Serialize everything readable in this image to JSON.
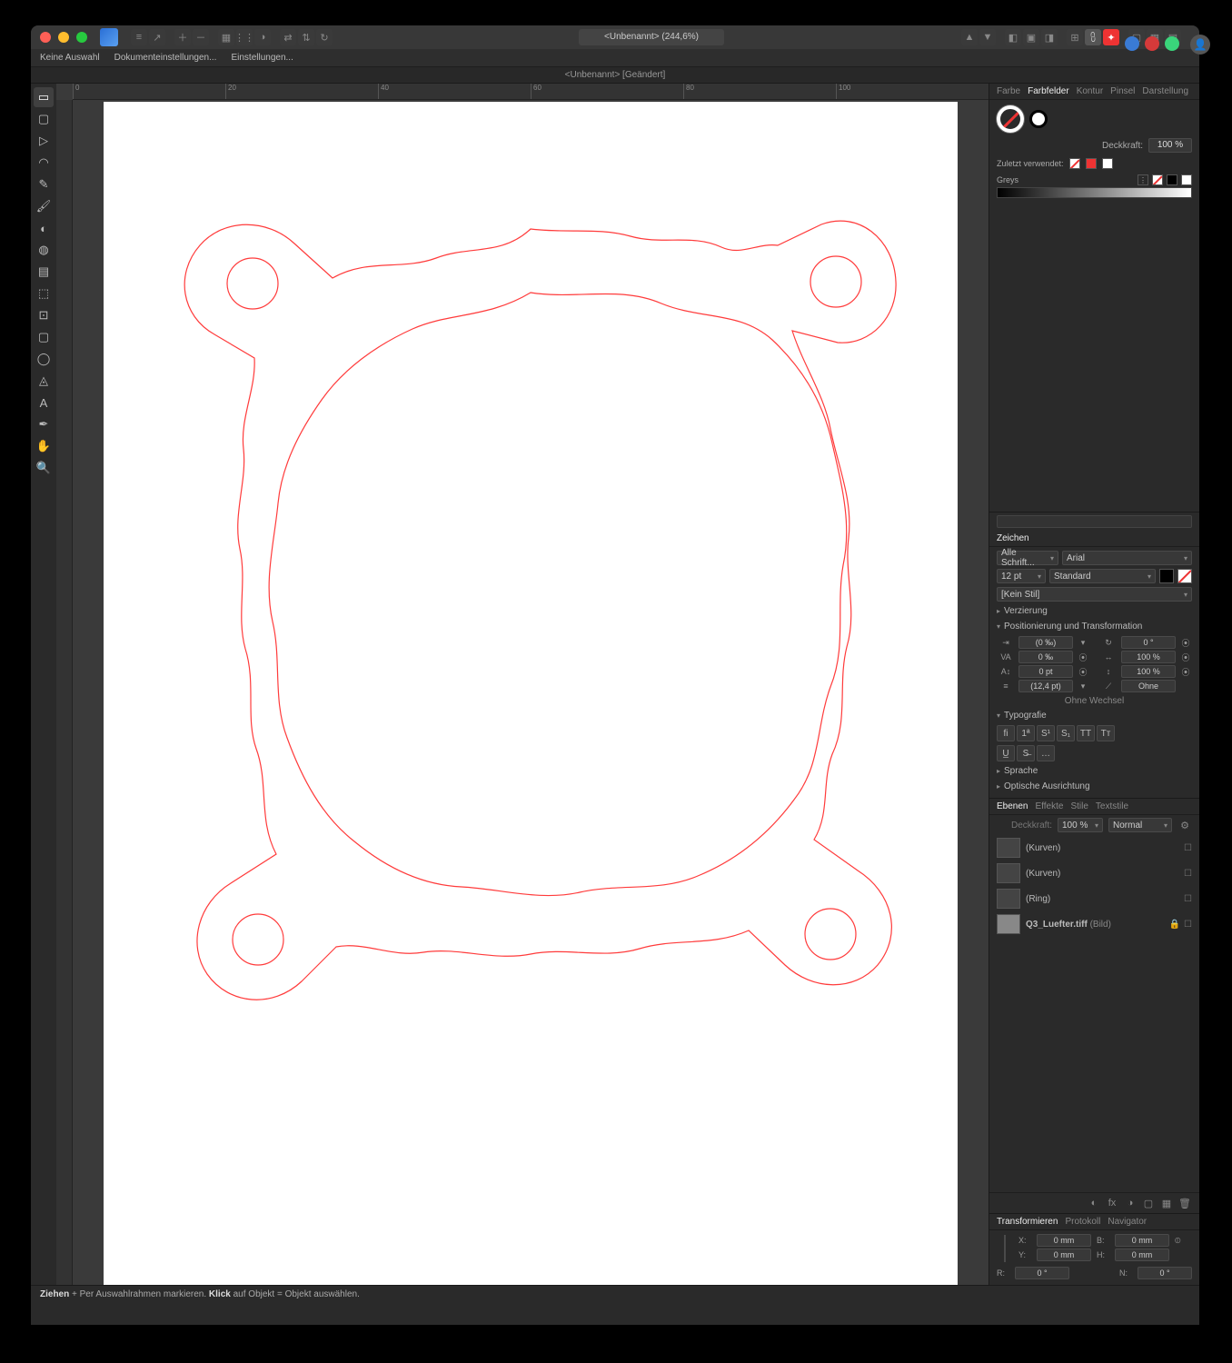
{
  "titlebar": {
    "doctitle": "<Unbenannt> (244,6%)"
  },
  "context": {
    "noSelection": "Keine Auswahl",
    "docSettings": "Dokumenteinstellungen...",
    "prefs": "Einstellungen..."
  },
  "tab": {
    "label": "<Unbenannt> [Geändert]"
  },
  "ruler": {
    "u0": "0",
    "u20": "20",
    "u40": "40",
    "u60": "60",
    "u80": "80",
    "u100": "100"
  },
  "swatchesPanel": {
    "tabs": {
      "farbe": "Farbe",
      "farbfelder": "Farbfelder",
      "kontur": "Kontur",
      "pinsel": "Pinsel",
      "darstellung": "Darstellung"
    },
    "opacityLabel": "Deckkraft:",
    "opacityVal": "100 %",
    "recentLabel": "Zuletzt verwendet:",
    "greysLabel": "Greys"
  },
  "search": {
    "placeholder": ""
  },
  "zeichen": {
    "tab": "Zeichen",
    "allFonts": "Alle Schrift...",
    "font": "Arial",
    "size": "12 pt",
    "style": "Standard",
    "noStyle": "[Kein Stil]",
    "dec": "Verzierung",
    "pos": "Positionierung und Transformation",
    "wechsel": "Ohne Wechsel",
    "typo": "Typografie",
    "lang": "Sprache",
    "optical": "Optische Ausrichtung",
    "spVA0": "(0 ‰)",
    "spVA1": "0 ‰",
    "spPT": "0 pt",
    "spLine": "(12,4 pt)",
    "rot": "0 °",
    "scale": "100 %",
    "scale2": "100 %",
    "ohne": "Ohne"
  },
  "layers": {
    "tabs": {
      "ebenen": "Ebenen",
      "effekte": "Effekte",
      "stile": "Stile",
      "textstile": "Textstile"
    },
    "opacityLabel": "Deckkraft:",
    "opacityVal": "100 %",
    "blend": "Normal",
    "row1": "(Kurven)",
    "row2": "(Kurven)",
    "row3": "(Ring)",
    "row4": "Q3_Luefter.tiff",
    "row4type": " (Bild)"
  },
  "transform": {
    "tabs": {
      "transformieren": "Transformieren",
      "protokoll": "Protokoll",
      "navigator": "Navigator"
    },
    "x": "X:",
    "y": "Y:",
    "b": "B:",
    "h": "H:",
    "r": "R:",
    "n": "N:",
    "xv": "0 mm",
    "yv": "0 mm",
    "bv": "0 mm",
    "hv": "0 mm",
    "rv": "0 °",
    "nv": "0 °"
  },
  "status": {
    "drag": "Ziehen",
    "dragTxt": " + Per Auswahlrahmen markieren. ",
    "klick": "Klick",
    "klickTxt": " auf Objekt = Objekt auswählen."
  }
}
